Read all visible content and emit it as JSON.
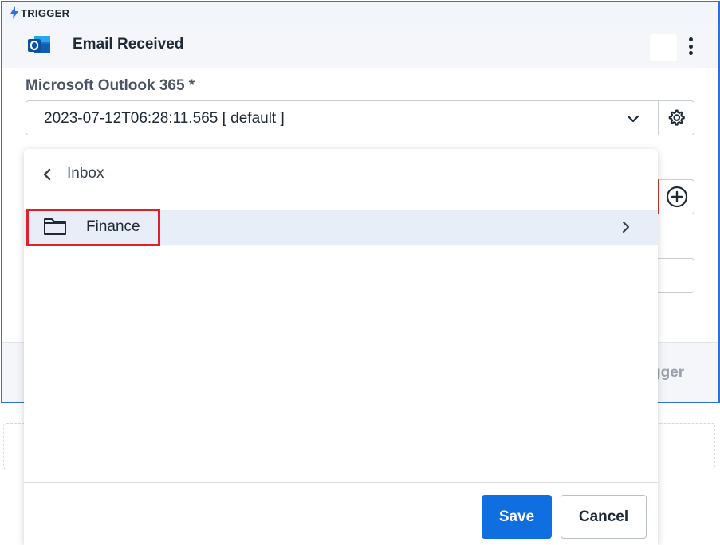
{
  "trigger": {
    "tag_label": "TRIGGER",
    "title": "Email Received",
    "footer_partial_text": "gger"
  },
  "connection": {
    "label": "Microsoft Outlook 365 *",
    "selected_value": "2023-07-12T06:28:11.565 [ default ]"
  },
  "folder_picker": {
    "current_folder": "Inbox",
    "items": [
      {
        "label": "Finance",
        "icon": "folder-icon",
        "has_children": true
      }
    ],
    "save_label": "Save",
    "cancel_label": "Cancel"
  },
  "colors": {
    "accent": "#0f6fe0",
    "card_border": "#2f6fe0",
    "highlight": "#e0202a",
    "selected_row": "#e8eef7"
  },
  "icons": {
    "app": "outlook-icon",
    "trigger": "lightning-bolt-icon",
    "settings": "gear-icon",
    "add": "plus-circle-icon",
    "more": "kebab-menu-icon"
  }
}
